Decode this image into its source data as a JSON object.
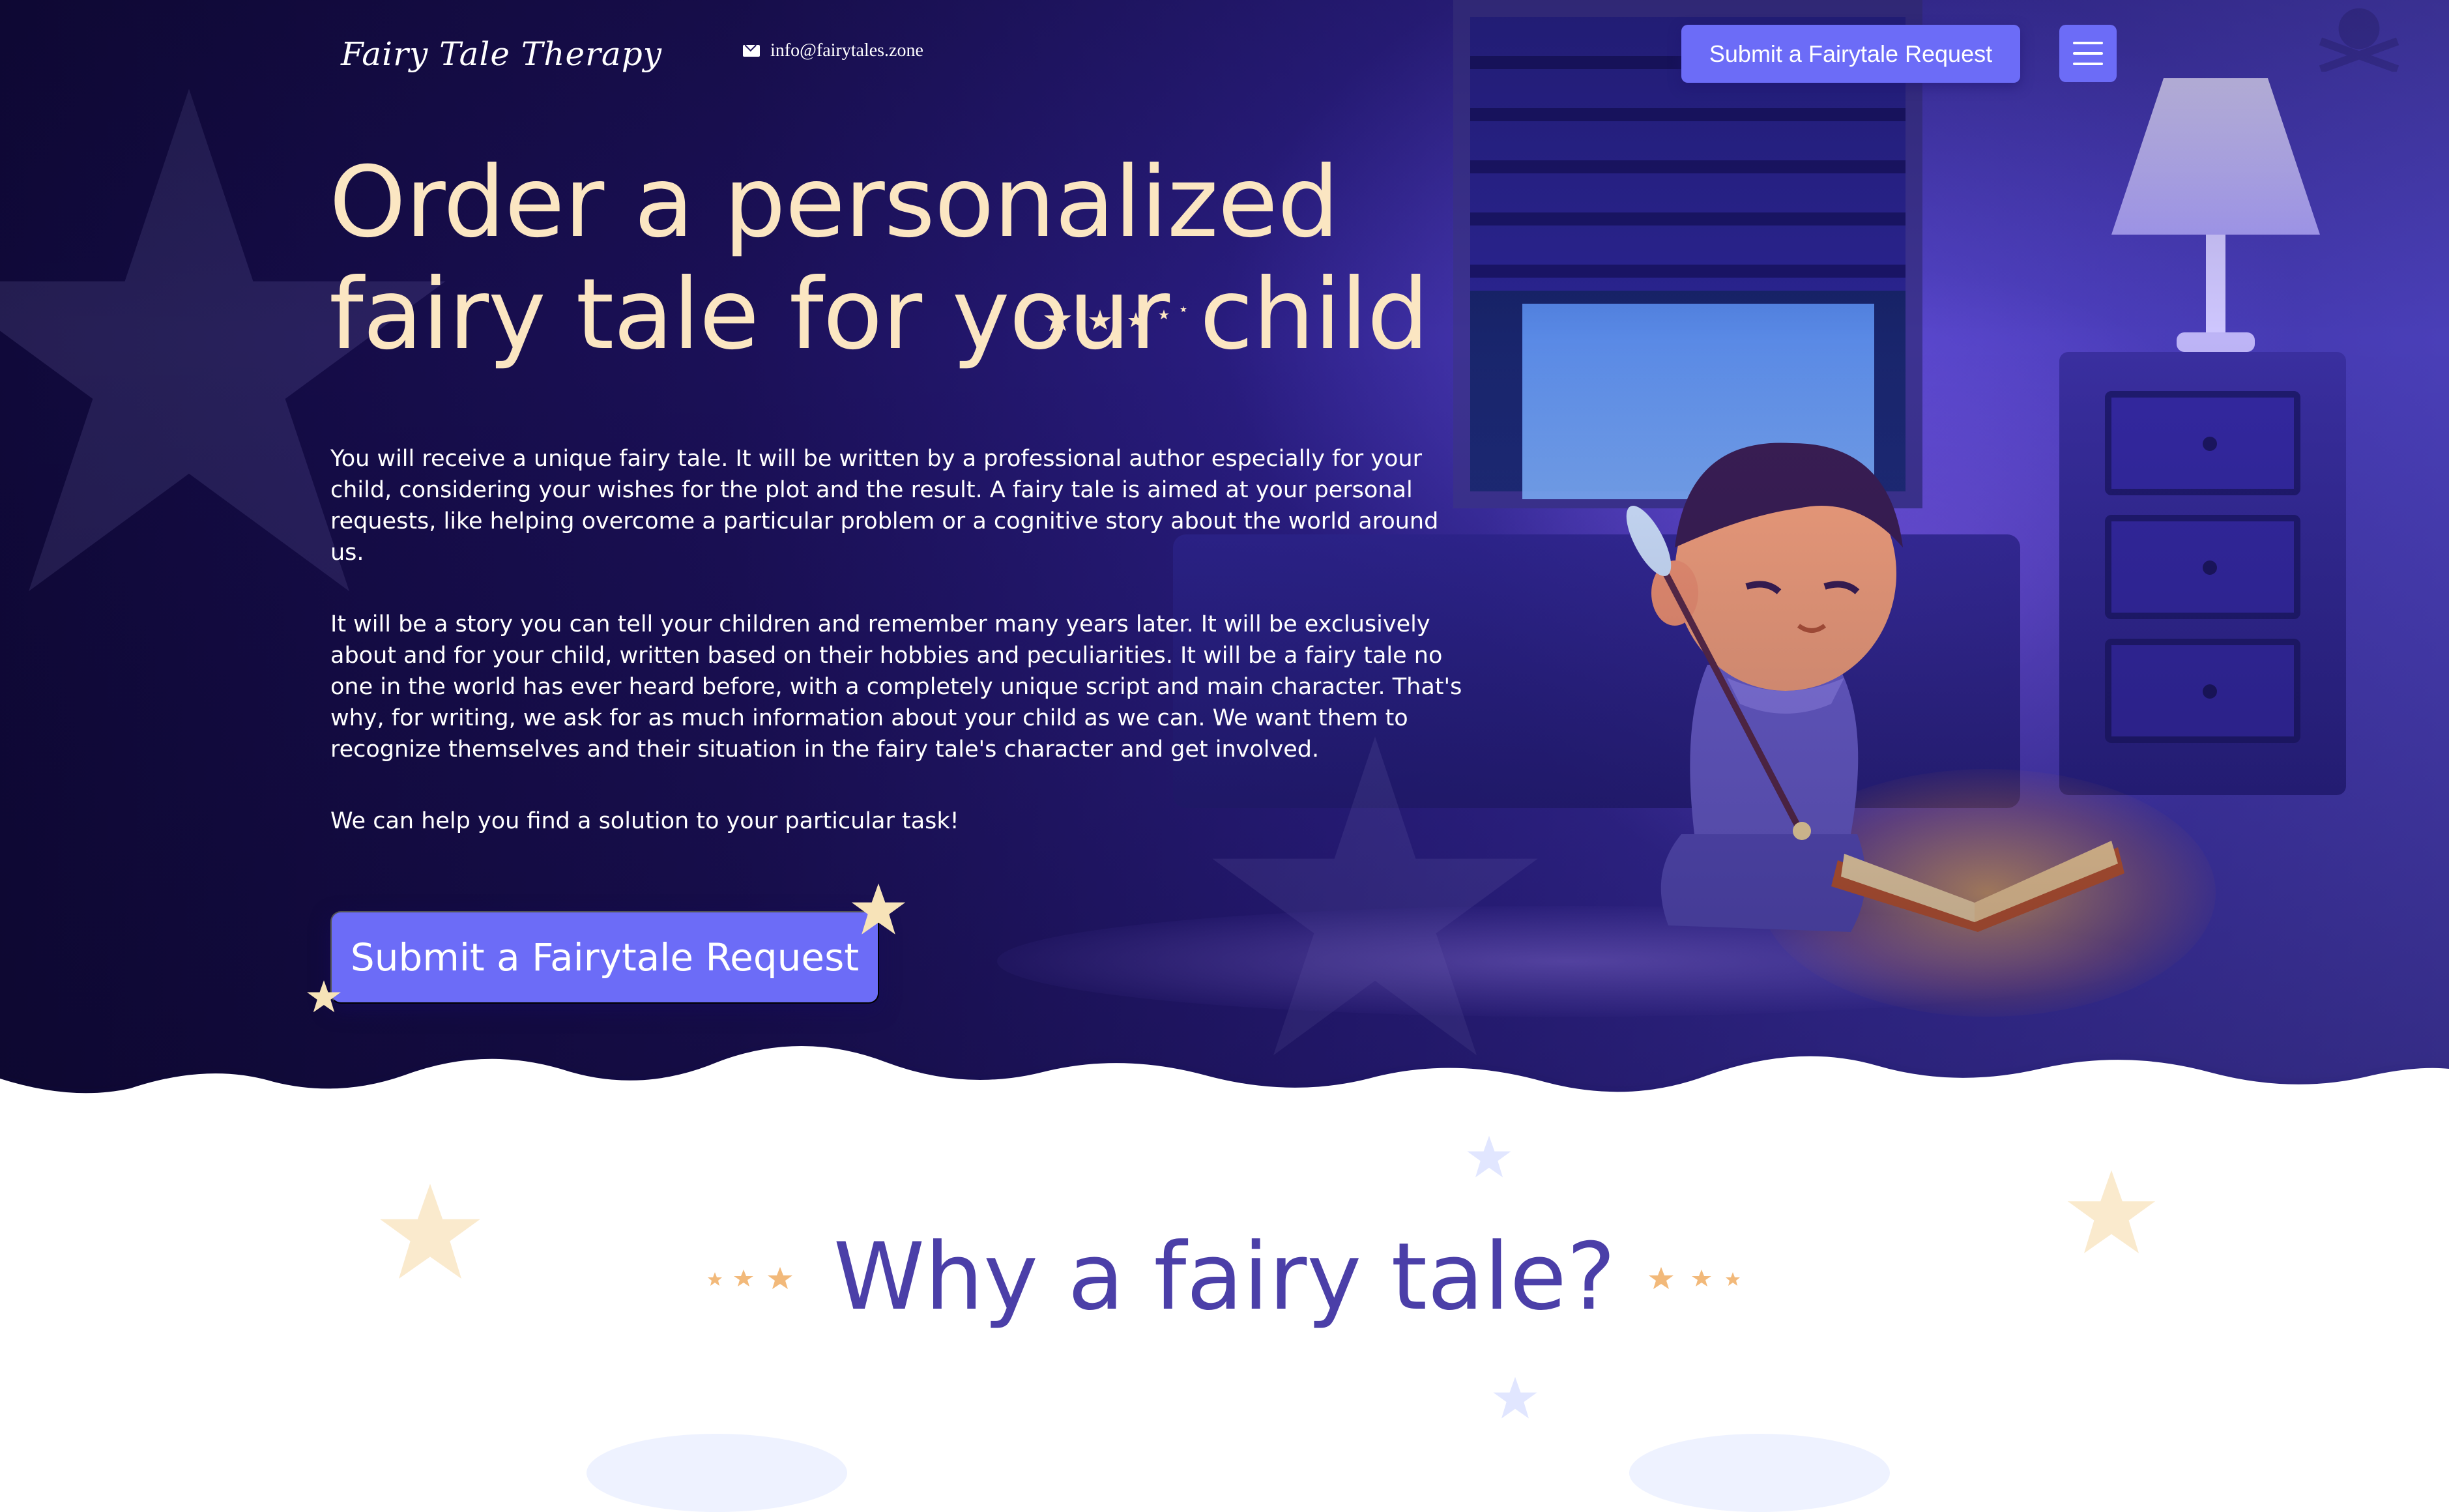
{
  "header": {
    "logo_text": "Fairy Tale Therapy",
    "email": "info@fairytales.zone",
    "submit_label": "Submit a Fairytale Request"
  },
  "hero": {
    "title": "Order a personalized fairy tale for your child",
    "paragraphs": [
      "You will receive a unique fairy tale. It will be written by a professional author especially for your child, considering your wishes for the plot and the result. A fairy tale is aimed at your personal requests, like helping overcome a particular problem or a cognitive story about the world around us.",
      "It will be a story you can tell your children and remember many years later. It will be exclusively about and for your child, written based on their hobbies and peculiarities. It will be a fairy tale no one in the world has ever heard before, with a completely unique script and main character. That's why, for writing, we ask for as much information about your child as we can. We want them to recognize themselves and their situation in the fairy tale's character and get involved.",
      "We can help you find a solution to your particular task!"
    ],
    "cta_label": "Submit a Fairytale Request"
  },
  "section_why": {
    "title": "Why a fairy tale?"
  },
  "icons": [
    "quill-book-icon",
    "mail-icon",
    "hamburger-menu-icon",
    "star-icon"
  ],
  "colors": {
    "accent_button": "#6c6cf7",
    "hero_title": "#fbe6c2",
    "section_title": "#4b3fa8",
    "star": "#f7e3b8"
  }
}
